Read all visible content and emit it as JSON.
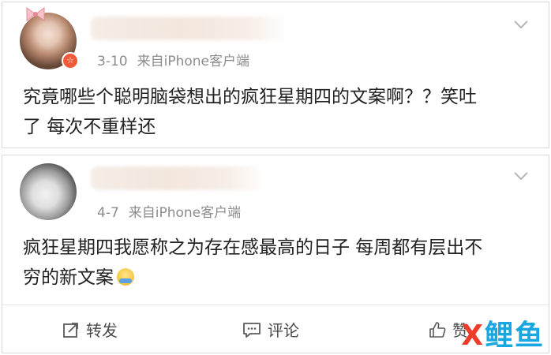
{
  "posts": [
    {
      "date": "3-10",
      "source": "来自iPhone客户端",
      "content": "究竟哪些个聪明脑袋想出的疯狂星期四的文案啊？？笑吐了 每次不重样还",
      "avatar_badge": "☆"
    },
    {
      "date": "4-7",
      "source": "来自iPhone客户端",
      "content": "疯狂星期四我愿称之为存在感最高的日子 每周都有层出不穷的新文案",
      "emoji": "smiling-emoji"
    }
  ],
  "actions": {
    "repost_label": "转发",
    "comment_label": "评论",
    "like_label": "赞"
  },
  "icons": {
    "repost": "repost-icon",
    "comment": "comment-icon",
    "like": "thumbs-up-icon",
    "more": "chevron-down-icon"
  },
  "watermark": {
    "mark": "X",
    "text": "鲤鱼"
  },
  "colors": {
    "meta_text": "#8c8c8c",
    "badge": "#f15b3a",
    "watermark_red": "#ef3b2a",
    "watermark_blue": "#18a7e0"
  }
}
